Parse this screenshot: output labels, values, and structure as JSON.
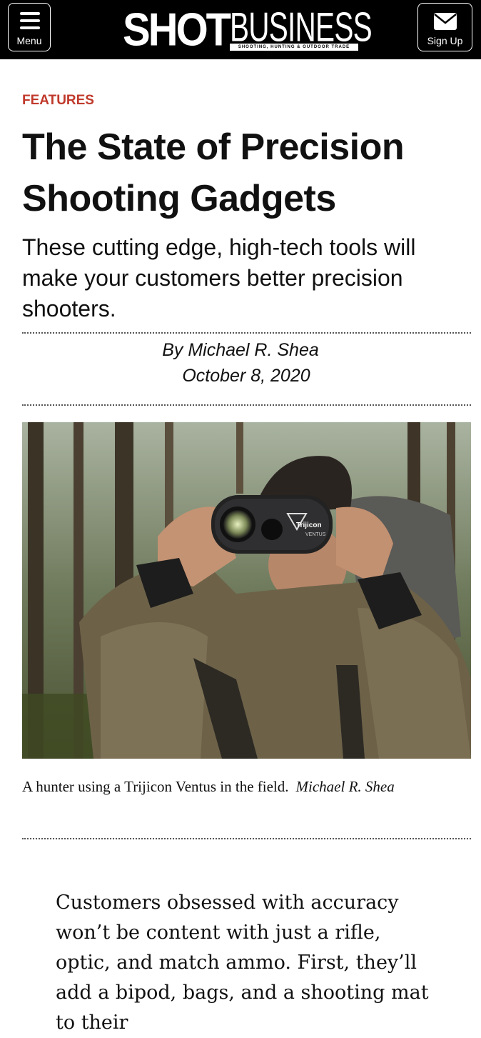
{
  "header": {
    "menu_label": "Menu",
    "signup_label": "Sign Up",
    "logo_shot": "SHOT",
    "logo_business": "BUSINESS",
    "logo_tagline": "SHOOTING, HUNTING & OUTDOOR TRADE"
  },
  "article": {
    "section": "FEATURES",
    "title": "The State of Precision Shooting Gadgets",
    "dek": "These cutting edge, high-tech tools will make your customers better precision shooters.",
    "byline": "By Michael R. Shea",
    "date": "October 8, 2020",
    "photo": {
      "device_brand": "Trijicon",
      "device_model": "VENTUS",
      "caption": "A hunter using a Trijicon Ventus in the field.",
      "credit": "Michael R. Shea"
    },
    "body": "Customers obsessed with accuracy won’t be content with just a rifle, optic, and match ammo. First, they’ll add a bipod, bags, and a shooting mat to their"
  },
  "colors": {
    "header_bg": "#000000",
    "section": "#c0392b"
  },
  "icons": {
    "menu": "hamburger-icon",
    "signup": "mail-icon"
  }
}
